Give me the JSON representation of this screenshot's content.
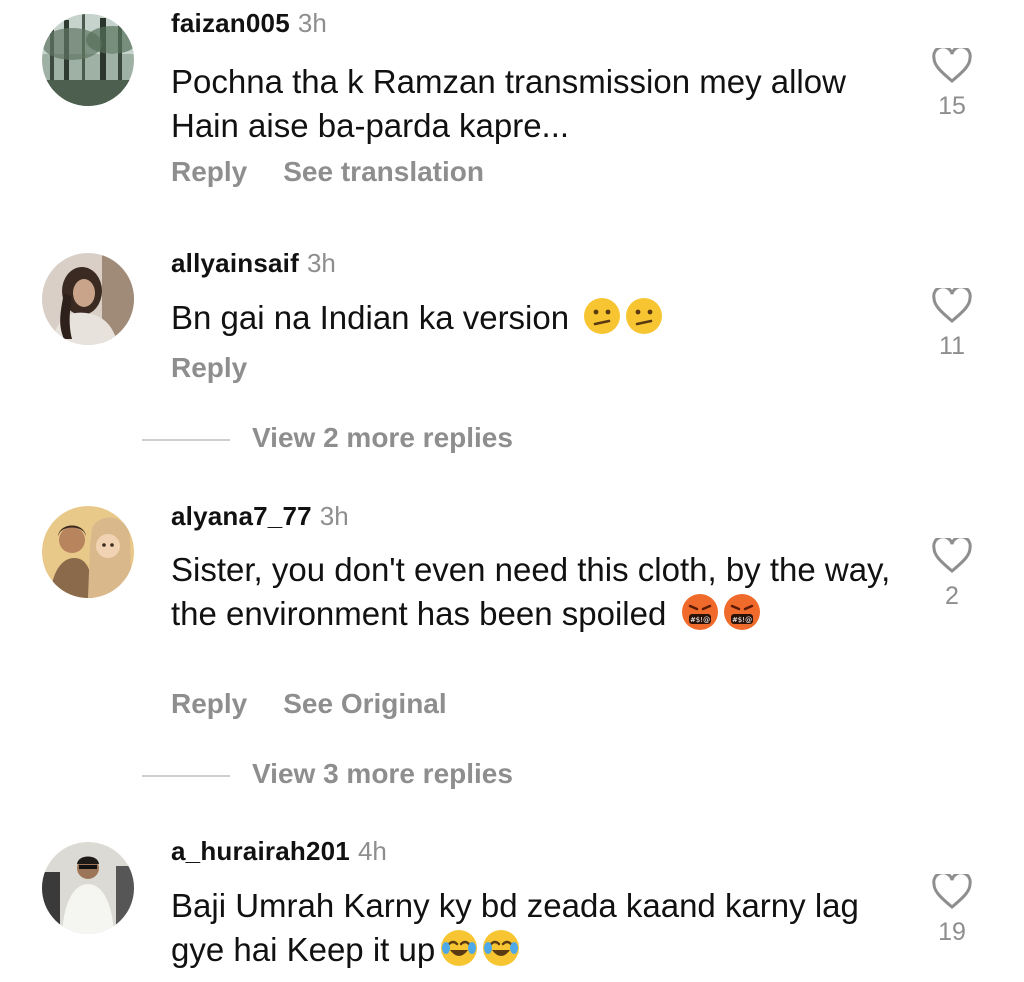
{
  "comments": [
    {
      "username": "faizan005",
      "time": "3h",
      "text": "Pochna tha k Ramzan transmission mey allow Hain aise ba-parda kapre...",
      "reply_label": "Reply",
      "secondary_label": "See translation",
      "likes": "15",
      "avatar_icon": "forest-photo-avatar"
    },
    {
      "username": "allyainsaif",
      "time": "3h",
      "text": "Bn gai na Indian ka version",
      "emojis": [
        "confused-face",
        "confused-face"
      ],
      "reply_label": "Reply",
      "likes": "11",
      "avatar_icon": "woman-photo-avatar"
    },
    {
      "username": "alyana7_77",
      "time": "3h",
      "text": "Sister, you don't even need this cloth, by the way, the environment has been spoiled",
      "emojis": [
        "angry-cursing-face",
        "angry-cursing-face"
      ],
      "reply_label": "Reply",
      "secondary_label": "See Original",
      "likes": "2",
      "avatar_icon": "illustrated-couple-avatar"
    },
    {
      "username": "a_hurairah201",
      "time": "4h",
      "text": "Baji Umrah Karny ky bd zeada kaand karny lag gye hai Keep it up",
      "emojis": [
        "tears-of-joy-face",
        "tears-of-joy-face"
      ],
      "likes": "19",
      "avatar_icon": "man-photo-avatar"
    }
  ],
  "view_replies": [
    "View 2 more replies",
    "View 3 more replies"
  ],
  "colors": {
    "text": "#111111",
    "secondary": "#8e8e8e",
    "divider": "#cfcfcf",
    "emoji_yellow": "#f7c531"
  }
}
